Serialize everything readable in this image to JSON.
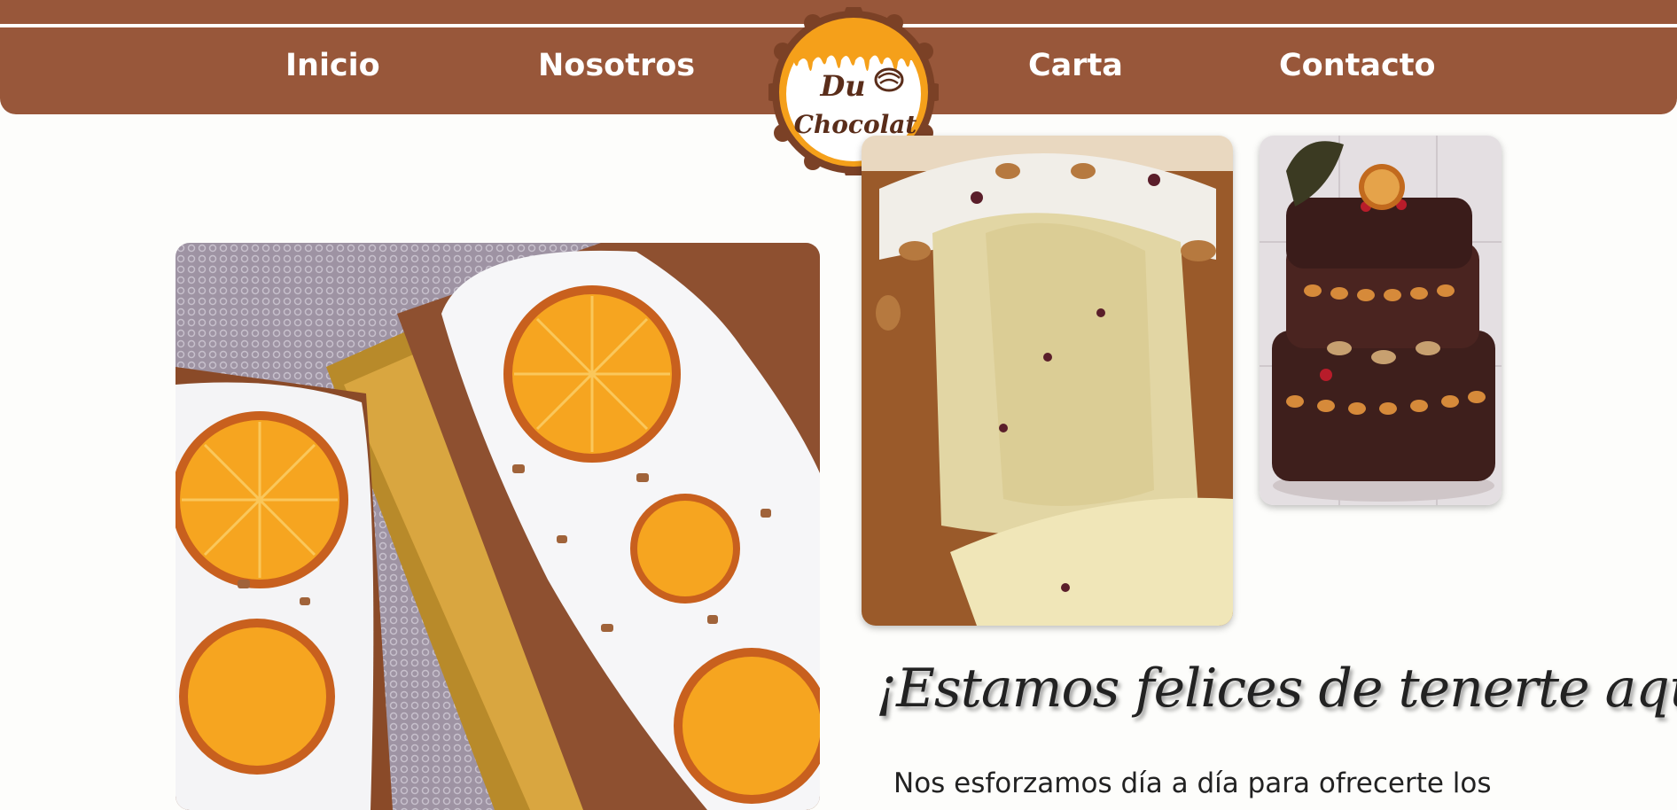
{
  "nav": {
    "items": [
      {
        "label": "Inicio"
      },
      {
        "label": "Nosotros"
      },
      {
        "label": "Carta"
      },
      {
        "label": "Contacto"
      }
    ]
  },
  "logo": {
    "line1": "Du",
    "line2": "Chocolat"
  },
  "images": {
    "loaf": "orange-glazed-loaf-cake",
    "panettone": "panettone-with-almonds",
    "cake": "chocolate-layer-cake"
  },
  "content": {
    "heading": "¡Estamos felices de tenerte aquí!",
    "paragraph": "Nos esforzamos día a día para ofrecerte los"
  },
  "colors": {
    "header_bg": "#98573a",
    "accent_orange": "#f5a01a",
    "page_bg": "#fdfdfb"
  }
}
